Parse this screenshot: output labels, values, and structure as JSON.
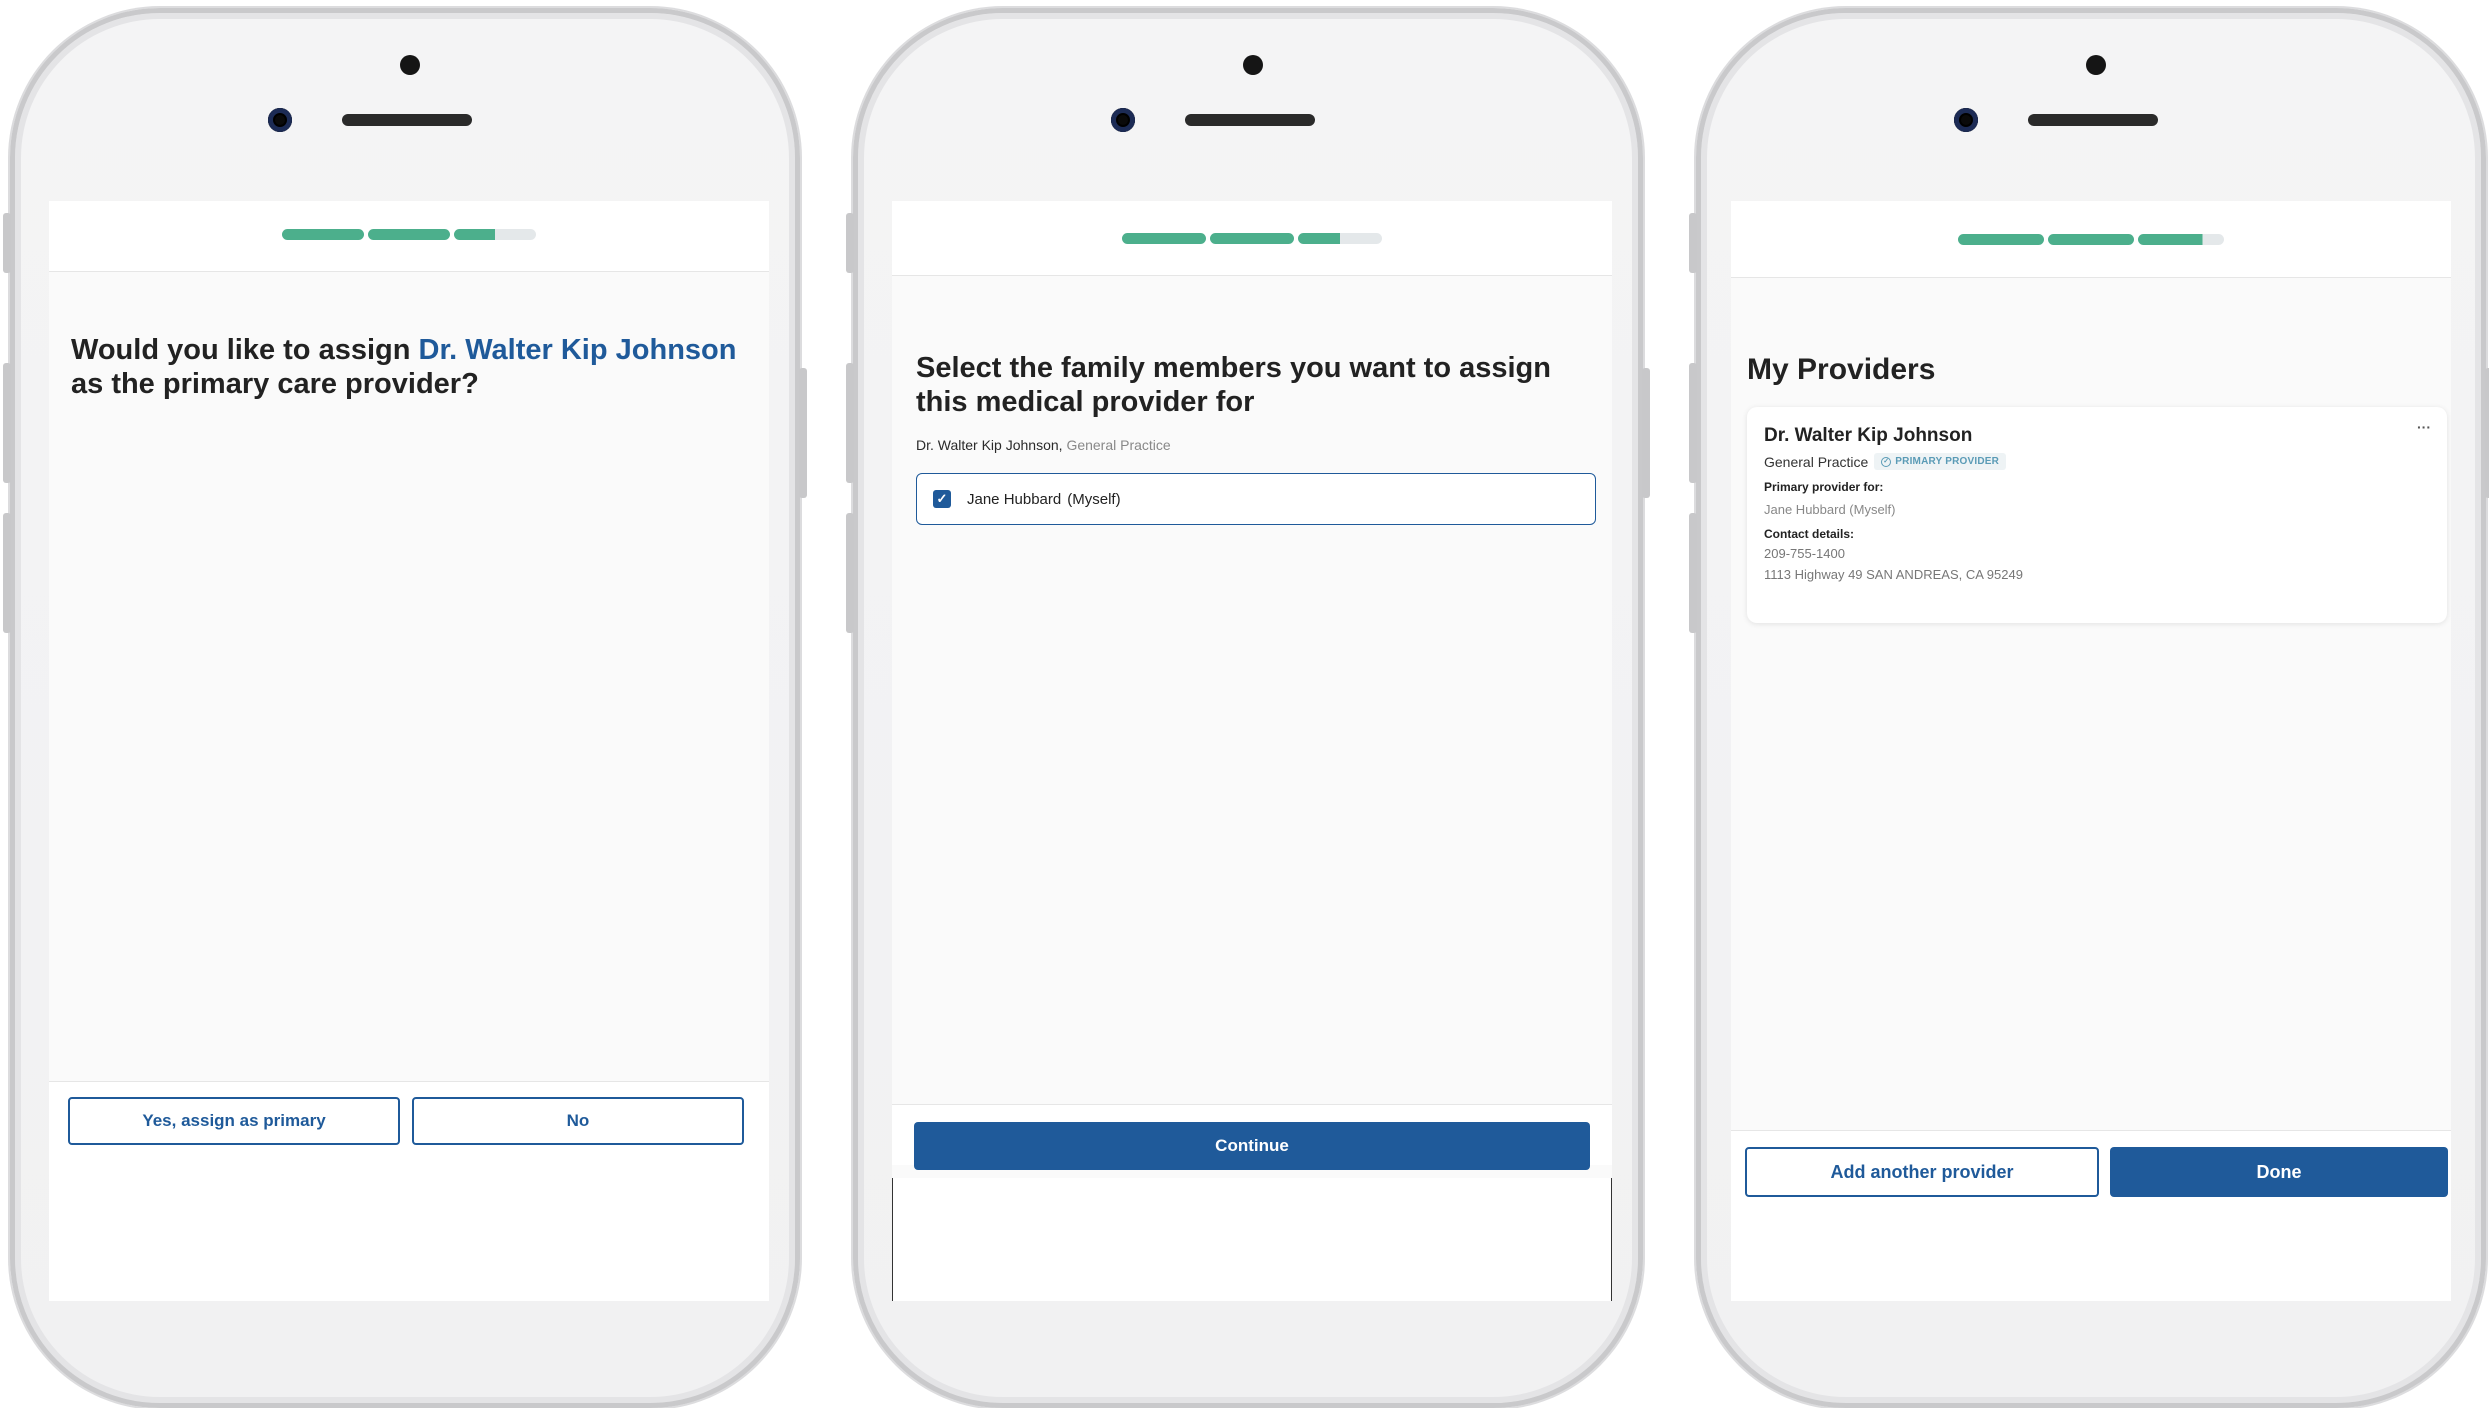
{
  "screen1": {
    "question_prefix": "Would you like to assign",
    "doctor_name": "Dr. Walter Kip Johnson",
    "question_suffix": "as the primary care provider?",
    "yes_label": "Yes, assign as primary",
    "no_label": "No",
    "progress": [
      1,
      1,
      0.5,
      0
    ]
  },
  "screen2": {
    "title": "Select the family members you want to assign this medical provider for",
    "doctor_name": "Dr. Walter Kip Johnson,",
    "specialty": "General Practice",
    "member_name": "Jane Hubbard",
    "member_relation": "(Myself)",
    "checked": true,
    "continue_label": "Continue",
    "progress": [
      1,
      1,
      0.5,
      0
    ]
  },
  "screen3": {
    "title": "My Providers",
    "card": {
      "doctor_name": "Dr. Walter Kip Johnson",
      "specialty": "General Practice",
      "badge": "PRIMARY PROVIDER",
      "menu": "···",
      "primary_for_label": "Primary provider for:",
      "primary_for_value": "Jane Hubbard (Myself)",
      "contact_label": "Contact details:",
      "phone": "209-755-1400",
      "address": "1113 Highway 49 SAN ANDREAS, CA 95249"
    },
    "add_label": "Add another provider",
    "done_label": "Done",
    "progress": [
      1,
      1,
      0.75,
      0
    ]
  },
  "colors": {
    "accent": "#1f5a9a",
    "progress_fill": "#4caf8c",
    "progress_track": "#e4e8ea"
  }
}
